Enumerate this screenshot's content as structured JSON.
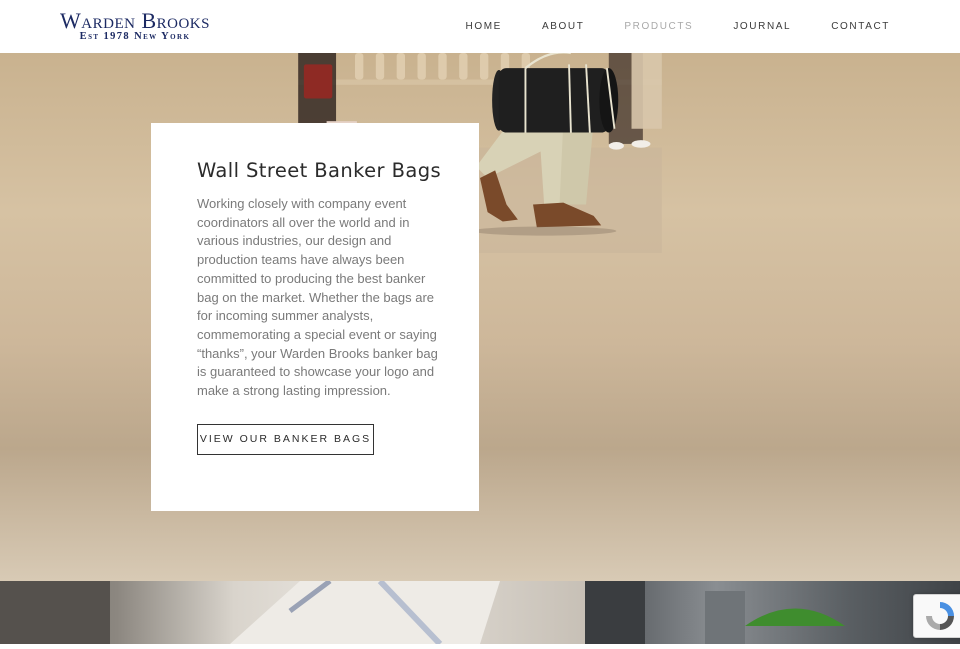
{
  "header": {
    "logo": {
      "name": "Warden Brooks",
      "tagline": "Est 1978 New York"
    },
    "nav": [
      {
        "label": "HOME",
        "active": false
      },
      {
        "label": "ABOUT",
        "active": false
      },
      {
        "label": "PRODUCTS",
        "active": true
      },
      {
        "label": "JOURNAL",
        "active": false
      },
      {
        "label": "CONTACT",
        "active": false
      }
    ]
  },
  "hero": {
    "title": "Wall Street Banker Bags",
    "body": "Working closely with company event coordinators all over the world and in various industries, our design and production teams have always been committed to producing the best banker bag on the market. Whether the bags are for incoming summer analysts, commemorating a special event or saying “thanks”, your Warden Brooks banker bag is guaranteed to showcase your logo and make a strong lasting impression.",
    "button_label": "VIEW OUR BANKER BAGS"
  },
  "colors": {
    "brand": "#1c2a63",
    "nav_text": "#3a3a3a",
    "nav_active": "#a9a9a9",
    "body_text": "#7a7a7a"
  }
}
